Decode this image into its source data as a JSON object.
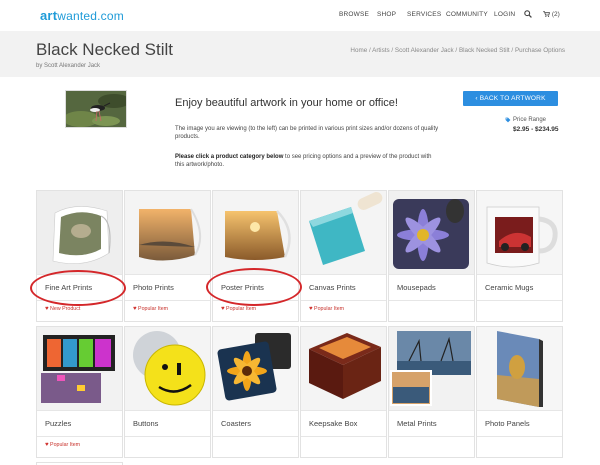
{
  "brand": {
    "logo_art": "art",
    "logo_rest": "wanted.com"
  },
  "nav": {
    "items": [
      "BROWSE",
      "SHOP",
      "SERVICES",
      "COMMUNITY",
      "LOGIN"
    ],
    "cart": "(2)"
  },
  "header": {
    "title": "Black Necked Stilt",
    "byline": "by Scott Alexander Jack",
    "breadcrumb": [
      "Home",
      "Artists",
      "Scott Alexander Jack",
      "Black Necked Stilt",
      "Purchase Options"
    ]
  },
  "intro": {
    "heading": "Enjoy beautiful artwork in your home or office!",
    "paragraph": "The image you are viewing (to the left) can be printed in various print sizes and/or dozens of quality products.",
    "instruction_bold": "Please click a product category below",
    "instruction_rest": " to see pricing options and a preview of the product with this artwork/photo."
  },
  "back_button": "BACK TO ARTWORK",
  "price": {
    "label": "Price Range",
    "value": "$2.95 - $234.95"
  },
  "products": [
    {
      "label": "Fine Art Prints",
      "badge": "New Product"
    },
    {
      "label": "Photo Prints",
      "badge": "Popular Item"
    },
    {
      "label": "Poster Prints",
      "badge": "Popular Item"
    },
    {
      "label": "Canvas Prints",
      "badge": "Popular Item"
    },
    {
      "label": "Mousepads",
      "badge": ""
    },
    {
      "label": "Ceramic Mugs",
      "badge": ""
    },
    {
      "label": "Puzzles",
      "badge": "Popular Item"
    },
    {
      "label": "Buttons",
      "badge": ""
    },
    {
      "label": "Coasters",
      "badge": ""
    },
    {
      "label": "Keepsake Box",
      "badge": ""
    },
    {
      "label": "Metal Prints",
      "badge": ""
    },
    {
      "label": "Photo Panels",
      "badge": ""
    }
  ],
  "colors": {
    "accent": "#1f9bd8",
    "button": "#2c8ee0",
    "highlight_ring": "#d4272a",
    "badge": "#c8332d"
  }
}
